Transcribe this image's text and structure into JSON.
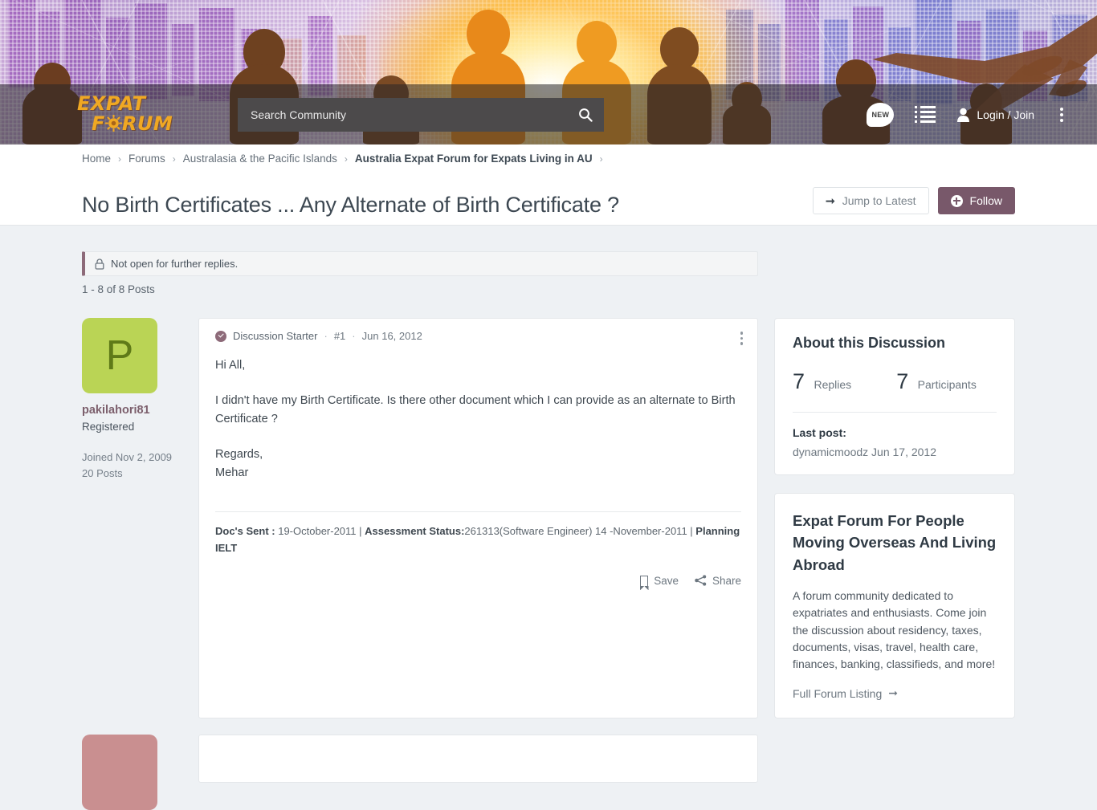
{
  "site": {
    "logo_line1": "EXPAT",
    "logo_line2": "FORUM"
  },
  "header": {
    "search_placeholder": "Search Community",
    "new_badge": "NEW",
    "login_label": "Login / Join"
  },
  "breadcrumb": [
    {
      "label": "Home",
      "current": false
    },
    {
      "label": "Forums",
      "current": false
    },
    {
      "label": "Australasia & the Pacific Islands",
      "current": false
    },
    {
      "label": "Australia Expat Forum for Expats Living in AU",
      "current": true
    }
  ],
  "thread": {
    "title": "No Birth Certificates ... Any Alternate of Birth Certificate ?",
    "jump_to_latest_label": "Jump to Latest",
    "follow_label": "Follow",
    "notice": "Not open for further replies.",
    "post_range": "1 - 8 of 8 Posts"
  },
  "post": {
    "author": "pakilahori81",
    "avatar_letter": "P",
    "avatar_color": "#bad455",
    "role": "Registered",
    "joined": "Joined Nov 2, 2009",
    "posts_count": "20 Posts",
    "badge": "Discussion Starter",
    "number": "#1",
    "date": "Jun 16, 2012",
    "separator": "·",
    "paragraphs": [
      "Hi All,",
      "I didn't have my Birth Certificate. Is there other document which I can provide as an alternate to Birth Certificate ?",
      "Regards,\nMehar"
    ],
    "signature_parts": [
      {
        "text": "Doc's Sent :",
        "bold": true
      },
      {
        "text": " 19-October-2011 | ",
        "bold": false
      },
      {
        "text": "Assessment Status:",
        "bold": true
      },
      {
        "text": "261313(Software Engineer) 14 -November-2011 | ",
        "bold": false
      },
      {
        "text": "Planning IELT",
        "bold": true
      }
    ],
    "save_label": "Save",
    "share_label": "Share"
  },
  "sidebar": {
    "about": {
      "title": "About this Discussion",
      "replies_count": "7",
      "replies_label": "Replies",
      "participants_count": "7",
      "participants_label": "Participants",
      "last_post_label": "Last post:",
      "last_post_value": "dynamicmoodz Jun 17, 2012"
    },
    "promo": {
      "title": "Expat Forum For People Moving Overseas And Living Abroad",
      "description": "A forum community dedicated to expatriates and enthusiasts. Come join the discussion about residency, taxes, documents, visas, travel, health care, finances, banking, classifieds, and more!",
      "link_label": "Full Forum Listing"
    }
  },
  "colors": {
    "accent": "#78586a",
    "avatar_green": "#bad455",
    "avatar_rose": "#c98f90",
    "logo_orange": "#f0a823",
    "page_bg": "#eef1f4"
  }
}
